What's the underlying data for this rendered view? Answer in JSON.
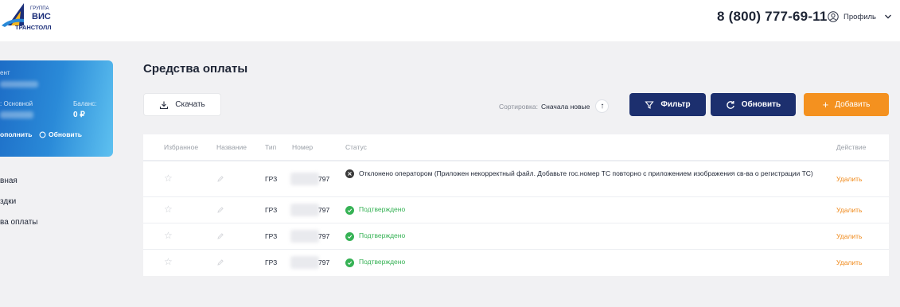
{
  "logo": {
    "line1": "ГРУППА",
    "line2": "ВИС",
    "line3": "ТРАНСТОЛЛ"
  },
  "header": {
    "phone": "8 (800) 777-69-11",
    "profile_label": "Профиль"
  },
  "account_card": {
    "client_label": "ент",
    "type_label": ": Основной",
    "balance_label": "Баланс:",
    "balance_value": "0 ₽",
    "topup_label": "ополнить",
    "refresh_label": "Обновить"
  },
  "sidebar": {
    "items": [
      {
        "label": "вная"
      },
      {
        "label": "здки"
      },
      {
        "label": "ва оплаты"
      }
    ]
  },
  "page": {
    "title": "Средства оплаты"
  },
  "toolbar": {
    "download_label": "Скачать",
    "sort_label": "Сортировка:",
    "sort_value": "Сначала новые",
    "filter_label": "Фильтр",
    "refresh_label": "Обновить",
    "add_label": "Добавить"
  },
  "table": {
    "columns": [
      "Избранное",
      "Название",
      "Тип",
      "Номер",
      "Статус",
      "Действие"
    ],
    "rows": [
      {
        "type": "ГРЗ",
        "number_suffix": "797",
        "status": "Отклонено оператором (Приложен некорректный файл. Добавьте гос.номер ТС повторно с приложением изображения св-ва о регистрации ТС)",
        "status_kind": "rejected",
        "action": "Удалить"
      },
      {
        "type": "ГРЗ",
        "number_suffix": "797",
        "status": "Подтверждено",
        "status_kind": "confirmed",
        "action": "Удалить"
      },
      {
        "type": "ГРЗ",
        "number_suffix": "797",
        "status": "Подтверждено",
        "status_kind": "confirmed",
        "action": "Удалить"
      },
      {
        "type": "ГРЗ",
        "number_suffix": "797",
        "status": "Подтверждено",
        "status_kind": "confirmed",
        "action": "Удалить"
      }
    ]
  },
  "colors": {
    "navy": "#1c2f6e",
    "orange": "#f4911f",
    "green": "#36b255",
    "rejected": "#3a3a3a",
    "action": "#f0891a"
  }
}
